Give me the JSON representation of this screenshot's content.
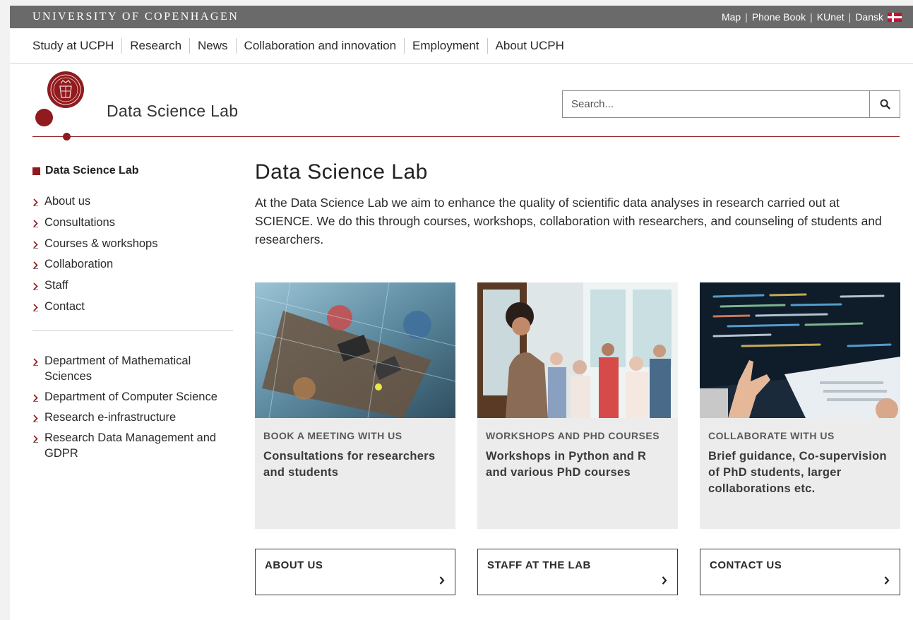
{
  "topbar": {
    "university": "UNIVERSITY OF COPENHAGEN",
    "links": [
      "Map",
      "Phone Book",
      "KUnet",
      "Dansk"
    ],
    "separator": "|"
  },
  "mainnav": {
    "items": [
      "Study at UCPH",
      "Research",
      "News",
      "Collaboration and innovation",
      "Employment",
      "About UCPH"
    ]
  },
  "header": {
    "site_title": "Data Science Lab",
    "search_placeholder": "Search..."
  },
  "sidebar": {
    "heading": "Data Science Lab",
    "items": [
      "About us",
      "Consultations",
      "Courses & workshops",
      "Collaboration",
      "Staff",
      "Contact"
    ],
    "related": [
      "Department of Mathematical Sciences",
      "Department of Computer Science",
      "Research e-infrastructure",
      "Research Data Management and GDPR"
    ]
  },
  "main": {
    "title": "Data Science Lab",
    "intro": "At the Data Science Lab we aim to enhance the quality of scientific data analyses in research carried out at SCIENCE. We do this through courses, workshops, collaboration with researchers, and counseling of students and researchers.",
    "cards": [
      {
        "kicker": "BOOK A MEETING WITH US",
        "headline": "Consultations for researchers and students"
      },
      {
        "kicker": "WORKSHOPS AND PHD COURSES",
        "headline": "Workshops in Python and R and various PhD courses"
      },
      {
        "kicker": "COLLABORATE WITH US",
        "headline": "Brief guidance, Co-supervision of PhD students, larger collaborations etc."
      }
    ],
    "buttons": [
      "ABOUT US",
      "STAFF AT THE LAB",
      "CONTACT US"
    ]
  },
  "colors": {
    "brand_red": "#901a1e",
    "topbar_gray": "#6a6a6a",
    "card_bg": "#ececec"
  },
  "icons": {
    "search": "magnifier-icon",
    "chevron": "chevron-right-icon",
    "flag": "danish-flag-icon",
    "seal": "university-seal-logo"
  }
}
